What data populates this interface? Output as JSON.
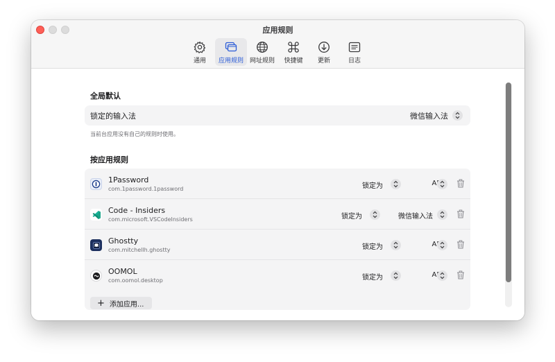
{
  "window": {
    "title": "应用规则"
  },
  "toolbar": {
    "items": [
      {
        "label": "通用",
        "icon": "gear-icon"
      },
      {
        "label": "应用规则",
        "icon": "app-windows-icon",
        "active": true
      },
      {
        "label": "网址规则",
        "icon": "globe-icon"
      },
      {
        "label": "快捷键",
        "icon": "command-icon"
      },
      {
        "label": "更新",
        "icon": "download-circle-icon"
      },
      {
        "label": "日志",
        "icon": "log-list-icon"
      }
    ]
  },
  "global": {
    "title": "全局默认",
    "lock_label": "锁定的输入法",
    "lock_value": "微信输入法",
    "hint": "当前台应用没有自己的规则时使用。"
  },
  "app_rules": {
    "title": "按应用规则",
    "rows": [
      {
        "name": "1Password",
        "bundle": "com.1password.1password",
        "lock_label": "锁定为",
        "input_method": "ABC",
        "icon": "onepassword-icon"
      },
      {
        "name": "Code - Insiders",
        "bundle": "com.microsoft.VSCodeInsiders",
        "lock_label": "锁定为",
        "input_method": "微信输入法",
        "icon": "vscode-insiders-icon"
      },
      {
        "name": "Ghostty",
        "bundle": "com.mitchellh.ghostty",
        "lock_label": "锁定为",
        "input_method": "ABC",
        "icon": "ghostty-icon"
      },
      {
        "name": "OOMOL",
        "bundle": "com.oomol.desktop",
        "lock_label": "锁定为",
        "input_method": "ABC",
        "icon": "oomol-icon"
      }
    ],
    "add_button": "添加应用..."
  },
  "colors": {
    "accent": "#2a5bd7",
    "close": "#fe5f57",
    "card_bg": "#f4f4f5"
  }
}
